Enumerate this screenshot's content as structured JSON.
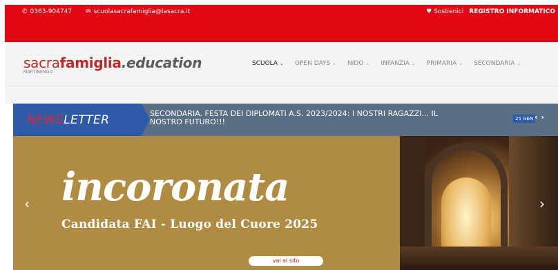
{
  "topbar": {
    "phone": "0363-904747",
    "email": "scuolasacrafamiglia@lasacra.it",
    "support": "Sostienici",
    "register": "REGISTRO INFORMATICO",
    "phone_icon": "phone-icon",
    "email_icon": "envelope-icon",
    "heart_icon": "heart-icon"
  },
  "logo": {
    "part1": "sacra",
    "part2": "famiglia",
    "part3": ".education",
    "sub": "MARTINENGO"
  },
  "nav": {
    "items": [
      {
        "label": "SCUOLA"
      },
      {
        "label": "OPEN DAYS"
      },
      {
        "label": "NIDO"
      },
      {
        "label": "INFANZIA"
      },
      {
        "label": "PRIMARIA"
      },
      {
        "label": "SECONDARIA"
      }
    ]
  },
  "newsletter": {
    "label_red": "NEWS",
    "label_white": "LETTER",
    "title": "SECONDARIA. FESTA DEI DIPLOMATI A.S. 2023/2024: I NOSTRI RAGAZZI... IL NOSTRO FUTURO!!!",
    "date": "25 GEN",
    "prev": "‹",
    "next": "›"
  },
  "slide": {
    "title": "incoronata",
    "subtitle": "Candidata FAI - Luogo del Cuore 2025",
    "button": "vai al sito",
    "left_arrow": "‹",
    "right_arrow": "›"
  },
  "colors": {
    "brand_red": "#e30613",
    "newsletter_blue": "#2f5aa8",
    "slide_gold": "#b08b42"
  }
}
